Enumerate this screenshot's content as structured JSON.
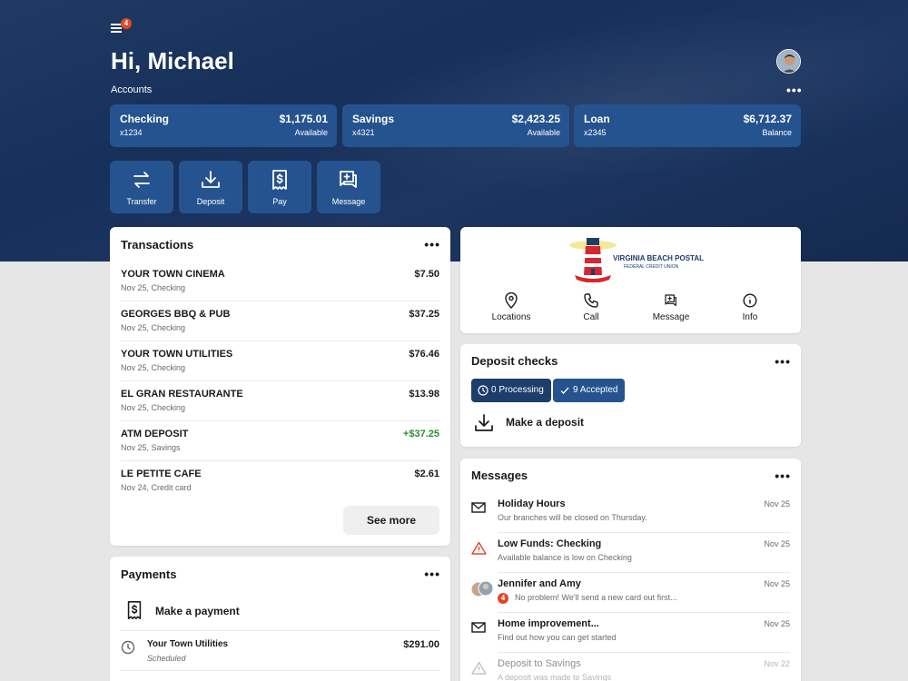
{
  "header": {
    "notification_count": "4",
    "greeting": "Hi, Michael",
    "accounts_label": "Accounts"
  },
  "accounts": [
    {
      "name": "Checking",
      "number": "x1234",
      "amount": "$1,175.01",
      "sub": "Available"
    },
    {
      "name": "Savings",
      "number": "x4321",
      "amount": "$2,423.25",
      "sub": "Available"
    },
    {
      "name": "Loan",
      "number": "x2345",
      "amount": "$6,712.37",
      "sub": "Balance"
    }
  ],
  "quick_actions": [
    {
      "label": "Transfer",
      "icon": "transfer-icon"
    },
    {
      "label": "Deposit",
      "icon": "download-icon"
    },
    {
      "label": "Pay",
      "icon": "bill-icon"
    },
    {
      "label": "Message",
      "icon": "message-icon"
    }
  ],
  "transactions": {
    "title": "Transactions",
    "items": [
      {
        "merchant": "YOUR TOWN CINEMA",
        "detail": "Nov 25, Checking",
        "amount": "$7.50"
      },
      {
        "merchant": "GEORGES BBQ & PUB",
        "detail": "Nov 25, Checking",
        "amount": "$37.25"
      },
      {
        "merchant": "YOUR TOWN UTILITIES",
        "detail": "Nov 25, Checking",
        "amount": "$76.46"
      },
      {
        "merchant": "EL GRAN RESTAURANTE",
        "detail": "Nov 25, Checking",
        "amount": "$13.98"
      },
      {
        "merchant": "ATM DEPOSIT",
        "detail": "Nov 25, Savings",
        "amount": "+$37.25"
      },
      {
        "merchant": "LE PETITE CAFE",
        "detail": "Nov 24, Credit card",
        "amount": "$2.61"
      }
    ],
    "see_more": "See more"
  },
  "payments": {
    "title": "Payments",
    "make_payment": "Make a payment",
    "items": [
      {
        "payee": "Your Town Utilities",
        "status": "Scheduled",
        "amount": "$291.00"
      }
    ]
  },
  "credit_union": {
    "logo_name": "VIRGINIA BEACH POSTAL",
    "logo_sub": "FEDERAL CREDIT UNION",
    "logo_since": "SINCE 1962",
    "actions": [
      {
        "label": "Locations",
        "icon": "location-pin-icon"
      },
      {
        "label": "Call",
        "icon": "phone-icon"
      },
      {
        "label": "Message",
        "icon": "message-icon"
      },
      {
        "label": "Info",
        "icon": "info-icon"
      }
    ]
  },
  "deposit_checks": {
    "title": "Deposit checks",
    "processing": "0 Processing",
    "accepted": "9 Accepted",
    "make_deposit": "Make a deposit"
  },
  "messages": {
    "title": "Messages",
    "group_badge": "4",
    "items": [
      {
        "title": "Holiday Hours",
        "snippet": "Our branches will be closed on Thursday.",
        "date": "Nov 25",
        "icon": "mail-icon"
      },
      {
        "title": "Low Funds: Checking",
        "snippet": "Available balance is low on Checking",
        "date": "Nov 25",
        "icon": "warning-icon"
      },
      {
        "title": "Jennifer and Amy",
        "snippet": "No problem! We'll send a new card out first...",
        "date": "Nov 25",
        "icon": "group-avatar-icon"
      },
      {
        "title": "Home improvement...",
        "snippet": "Find out how you can get started",
        "date": "Nov 25",
        "icon": "mail-icon"
      },
      {
        "title": "Deposit to Savings",
        "snippet": "A deposit was made to Savings",
        "date": "Nov 22",
        "icon": "warning-icon"
      }
    ]
  },
  "colors": {
    "hero": "#1a3460",
    "tile": "#25538f",
    "pill": "#1d3d6b",
    "positive": "#2e8b2e",
    "alert": "#e0482a"
  }
}
